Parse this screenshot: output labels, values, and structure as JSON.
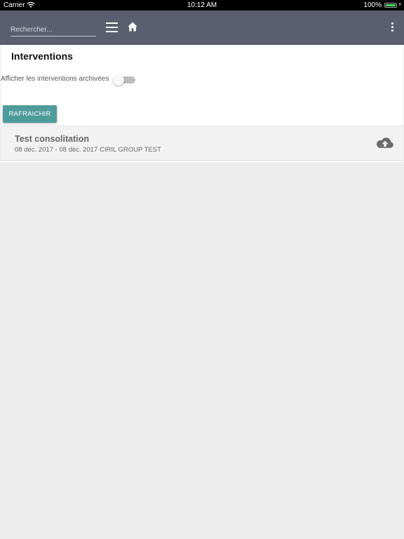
{
  "status_bar": {
    "carrier": "Carrier",
    "time": "10:12 AM",
    "battery": "100%"
  },
  "toolbar": {
    "search_placeholder": "Rechercher..."
  },
  "page": {
    "title": "Interventions",
    "archive_toggle_label": "Afficher les interventions archivées",
    "archive_toggle_on": false,
    "refresh_label": "RAFRAICHIR"
  },
  "interventions": [
    {
      "title": "Test consolitation",
      "subtitle": "08 déc. 2017 - 08 déc. 2017 CIRIL GROUP TEST",
      "icon": "cloud-upload-icon"
    }
  ],
  "colors": {
    "toolbar_bg": "#5a5f70",
    "button_bg": "#4d9b9b",
    "page_bg": "#ececec"
  }
}
